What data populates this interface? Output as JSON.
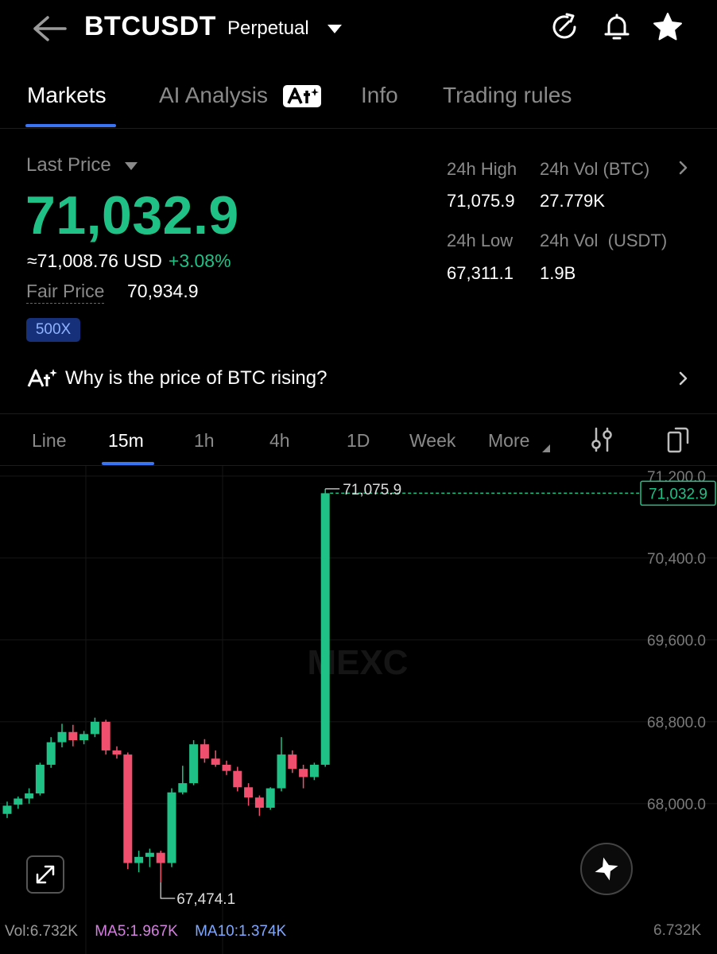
{
  "header": {
    "symbol": "BTCUSDT",
    "contract_type": "Perpetual",
    "icons": [
      "back-arrow-icon",
      "caret-down-icon",
      "refresh-icon",
      "bell-icon",
      "star-icon"
    ]
  },
  "tabs": [
    {
      "label": "Markets",
      "active": true
    },
    {
      "label": "AI Analysis",
      "active": false
    },
    {
      "label": "Info",
      "active": false
    },
    {
      "label": "Trading rules",
      "active": false
    }
  ],
  "price": {
    "label": "Last Price",
    "last": "71,032.9",
    "usd": "≈71,008.76 USD",
    "change": "+3.08%",
    "fair_label": "Fair Price",
    "fair_value": "70,934.9",
    "leverage": "500X"
  },
  "stats": {
    "high_label": "24h High",
    "high_value": "71,075.9",
    "vol_btc_label": "24h Vol (BTC)",
    "vol_btc_value": "27.779K",
    "low_label": "24h Low",
    "low_value": "67,311.1",
    "vol_usdt_label": "24h Vol  (USDT)",
    "vol_usdt_value": "1.9B"
  },
  "insight": {
    "text": "Why is the price of BTC rising?"
  },
  "timeframes": [
    {
      "label": "Line",
      "active": false
    },
    {
      "label": "15m",
      "active": true
    },
    {
      "label": "1h",
      "active": false
    },
    {
      "label": "4h",
      "active": false
    },
    {
      "label": "1D",
      "active": false
    },
    {
      "label": "Week",
      "active": false
    },
    {
      "label": "More",
      "active": false
    }
  ],
  "colors": {
    "up": "#1fc187",
    "down": "#f0506e",
    "accent": "#3a74f2",
    "ma5": "#d57fe0",
    "ma10": "#7fa8ff"
  },
  "chart_data": {
    "type": "candlestick",
    "y_ticks": [
      "71,200.0",
      "70,400.0",
      "69,600.0",
      "68,800.0",
      "68,000.0"
    ],
    "y_tick_values": [
      71200,
      70400,
      69600,
      68800,
      68000
    ],
    "ylim": [
      67300,
      71300
    ],
    "last_price_tag": "71,032.9",
    "last_price": 71032.9,
    "high_label": "71,075.9",
    "low_label": "67,474.1",
    "watermark": "MEXC",
    "candles": [
      [
        67900,
        68020,
        67860,
        67980
      ],
      [
        67990,
        68070,
        67950,
        68050
      ],
      [
        68050,
        68150,
        68000,
        68100
      ],
      [
        68100,
        68400,
        68080,
        68380
      ],
      [
        68380,
        68650,
        68350,
        68600
      ],
      [
        68600,
        68780,
        68550,
        68700
      ],
      [
        68700,
        68770,
        68560,
        68620
      ],
      [
        68620,
        68710,
        68580,
        68680
      ],
      [
        68680,
        68840,
        68650,
        68800
      ],
      [
        68800,
        68820,
        68480,
        68520
      ],
      [
        68520,
        68560,
        68440,
        68480
      ],
      [
        68480,
        68500,
        67360,
        67420
      ],
      [
        67420,
        67540,
        67330,
        67480
      ],
      [
        67480,
        67560,
        67380,
        67520
      ],
      [
        67520,
        67540,
        67230,
        67420
      ],
      [
        67420,
        68150,
        67380,
        68110
      ],
      [
        68110,
        68370,
        68090,
        68200
      ],
      [
        68200,
        68620,
        68180,
        68580
      ],
      [
        68580,
        68630,
        68400,
        68440
      ],
      [
        68440,
        68520,
        68360,
        68380
      ],
      [
        68380,
        68420,
        68280,
        68320
      ],
      [
        68320,
        68360,
        68120,
        68160
      ],
      [
        68160,
        68200,
        67980,
        68060
      ],
      [
        68060,
        68080,
        67880,
        67960
      ],
      [
        67960,
        68160,
        67940,
        68150
      ],
      [
        68150,
        68650,
        68120,
        68480
      ],
      [
        68480,
        68520,
        68300,
        68340
      ],
      [
        68340,
        68380,
        68150,
        68260
      ],
      [
        68260,
        68400,
        68230,
        68380
      ],
      [
        68380,
        71075.9,
        68360,
        71032.9
      ]
    ]
  },
  "volume": {
    "vol": "Vol:6.732K",
    "ma5": "MA5:1.967K",
    "ma10": "MA10:1.374K",
    "axis": "6.732K"
  }
}
